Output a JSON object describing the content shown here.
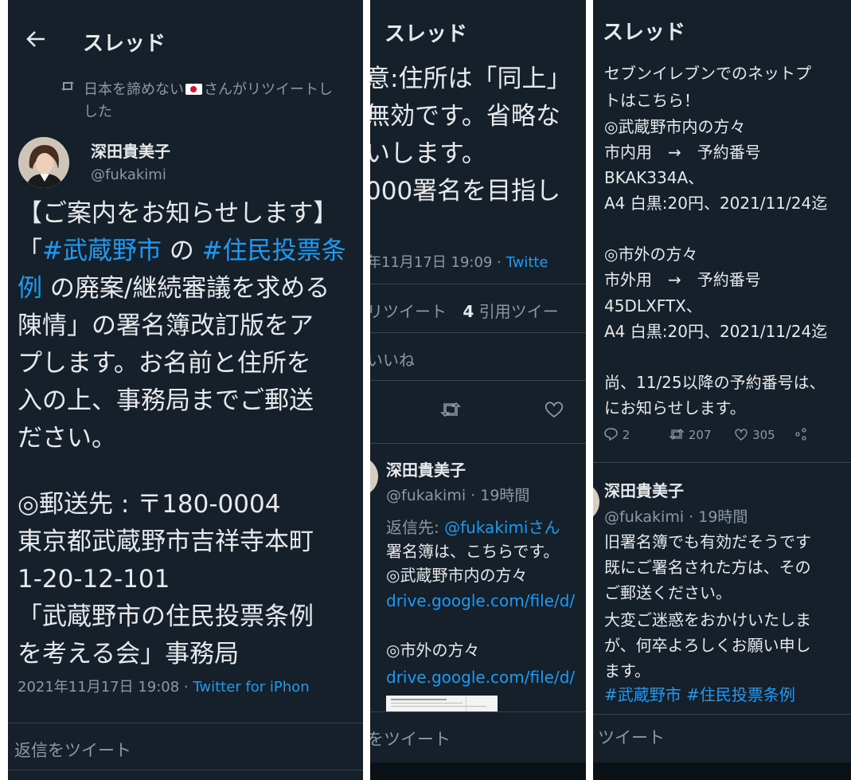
{
  "panel1": {
    "status_bar_fragment": "",
    "header": {
      "back_icon": "back-arrow-icon",
      "title": "スレッド"
    },
    "retweet_notice": {
      "icon": "retweet-icon",
      "line1": "日本を諦めない",
      "line1b": "さんがリツイートし",
      "line2": "した"
    },
    "author": {
      "name": "深田貴美子",
      "handle": "@fukakimi"
    },
    "body": {
      "l1": "【ご案内をお知らせします】",
      "l2_open": "「",
      "l2_tag1": "#武蔵野市",
      "l2_mid": " の ",
      "l2_tag2": "#住民投票条",
      "l3_tag": "例",
      "l3_rest": " の廃案/継続審議を求める",
      "l4": "陳情」の署名簿改訂版をア",
      "l5": "プします。お名前と住所を",
      "l6": "入の上、事務局までご郵送",
      "l7": "ださい。",
      "l8": "◎郵送先 : 〒180-0004",
      "l9": "東京都武蔵野市吉祥寺本町",
      "l10": "1-20-12-101",
      "l11": "「武蔵野市の住民投票条例",
      "l12": "を考える会」事務局"
    },
    "meta": {
      "datetime": "2021年11月17日 19:08 · ",
      "client": "Twitter for iPhon"
    },
    "reply_placeholder": "返信をツイート"
  },
  "panel2": {
    "header_title": "スレッド",
    "body": {
      "l1": "意:住所は「同上」",
      "l2": "無効です。省略な",
      "l3": "いします。",
      "l4": "000署名を目指し"
    },
    "meta": {
      "datetime": "年11月17日 19:09 · ",
      "client": "Twitte"
    },
    "stats": {
      "retweets_label": "リツイート",
      "quotes_count": "4",
      "quotes_label": "引用ツイー"
    },
    "likes_label": "いいね",
    "reply": {
      "name": "深田貴美子",
      "handle_time": "@fukakimi · 19時間",
      "replying_to_label": "返信先: ",
      "replying_to_user": "@fukakimiさん",
      "l1": "署名簿は、こちらです。",
      "l2": "◎武蔵野市内の方々",
      "link1": "drive.google.com/file/d/",
      "l3": "◎市外の方々",
      "link2": "drive.google.com/file/d/"
    },
    "reply_placeholder": "をツイート"
  },
  "panel3": {
    "header_title": "スレッド",
    "body": {
      "l1": "セブンイレブンでのネットプ",
      "l2": "トはこちら！",
      "l3": "◎武蔵野市内の方々",
      "l4": "市内用　→　予約番号",
      "l5": "BKAK334A、",
      "l6": "A4 白黒:20円、2021/11/24迄",
      "l7": "◎市外の方々",
      "l8": "市外用　→　予約番号",
      "l9": "45DLXFTX、",
      "l10": "A4 白黒:20円、2021/11/24迄",
      "l11": "尚、11/25以降の予約番号は、",
      "l12": "にお知らせします。"
    },
    "actions": {
      "replies": "2",
      "retweets": "207",
      "likes": "305"
    },
    "reply": {
      "name": "深田貴美子",
      "handle_time": "@fukakimi · 19時間",
      "l1": "旧署名簿でも有効だそうです",
      "l2": "既にご署名された方は、その",
      "l3": "ご郵送ください。",
      "l4": "大変ご迷惑をおかけいたしま",
      "l5": "が、何卒よろしくお願い申し",
      "l6": "ます。",
      "tags": "#武蔵野市 #住民投票条例"
    },
    "reply_placeholder": "ツイート"
  }
}
